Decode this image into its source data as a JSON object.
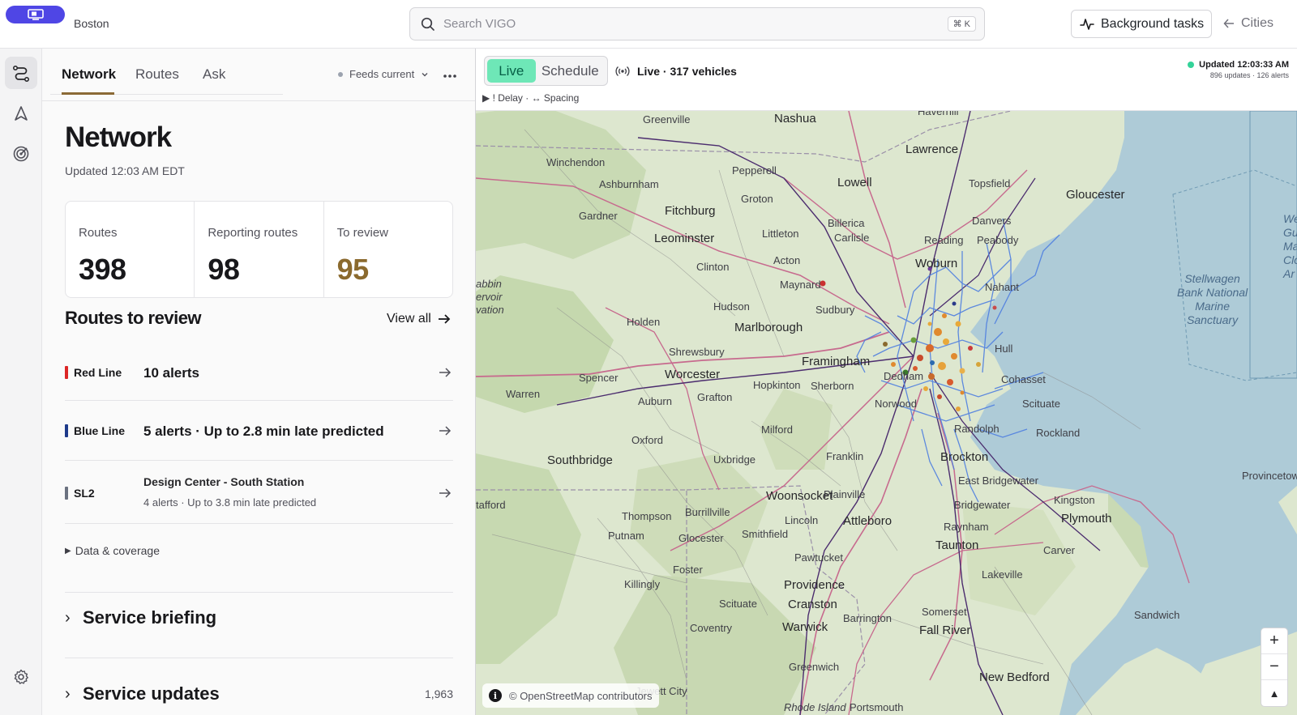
{
  "app": {
    "city": "Boston",
    "search_placeholder": "Search VIGO",
    "search_shortcut": "⌘ K",
    "background_tasks": "Background tasks",
    "cities_link": "Cities"
  },
  "rail": {
    "items": [
      "network-icon",
      "navigation-icon",
      "radar-icon"
    ],
    "bottom": "settings-icon"
  },
  "panel": {
    "tabs": [
      {
        "label": "Network",
        "active": true
      },
      {
        "label": "Routes",
        "active": false
      },
      {
        "label": "Ask",
        "active": false
      }
    ],
    "feeds_status": "Feeds current",
    "title": "Network",
    "updated": "Updated 12:03 AM EDT",
    "stats": [
      {
        "label": "Routes",
        "value": "398"
      },
      {
        "label": "Reporting routes",
        "value": "98"
      },
      {
        "label": "To review",
        "value": "95"
      }
    ],
    "review_title": "Routes to review",
    "view_all": "View all",
    "review_items": [
      {
        "name": "Red Line",
        "color": "#dc2626",
        "main": "10 alerts"
      },
      {
        "name": "Blue Line",
        "color": "#1e3a8a",
        "main": "5 alerts · Up to 2.8 min late predicted"
      },
      {
        "name": "SL2",
        "color": "#6b7280",
        "title": "Design Center - South Station",
        "sub": "4 alerts · Up to 3.8 min late predicted"
      }
    ],
    "data_coverage": "Data & coverage",
    "service_briefing": "Service briefing",
    "service_updates": "Service updates",
    "service_updates_count": "1,963"
  },
  "map": {
    "mode_live": "Live",
    "mode_schedule": "Schedule",
    "live_status": "Live · 317 vehicles",
    "legend": "▶ ! Delay · ↔ Spacing",
    "updated": "Updated 12:03:33 AM",
    "updated_sub": "896 updates · 126 alerts",
    "attribution": "© OpenStreetMap contributors",
    "zoom_in": "+",
    "zoom_out": "−",
    "reset_north": "▲",
    "places": {
      "haverhill": "Haverhill",
      "nashua": "Nashua",
      "greenville": "Greenville",
      "lawrence": "Lawrence",
      "winchendon": "Winchendon",
      "ashburnham": "Ashburnham",
      "pepperell": "Pepperell",
      "lowell": "Lowell",
      "topsfield": "Topsfield",
      "gloucester": "Gloucester",
      "groton": "Groton",
      "gardner": "Gardner",
      "fitchburg": "Fitchburg",
      "billerica": "Billerica",
      "danvers": "Danvers",
      "leominster": "Leominster",
      "littleton": "Littleton",
      "carlisle": "Carlisle",
      "reading": "Reading",
      "peabody": "Peabody",
      "acton": "Acton",
      "woburn": "Woburn",
      "petersham": "abbin\nervoir\nvation",
      "clinton": "Clinton",
      "maynard": "Maynard",
      "nahant": "Nahant",
      "hudson": "Hudson",
      "sudbury": "Sudbury",
      "holden": "Holden",
      "marlborough": "Marlborough",
      "shrewsbury": "Shrewsbury",
      "framingham": "Framingham",
      "worcester": "Worcester",
      "hull": "Hull",
      "dedham": "Dedham",
      "cohasset": "Cohasset",
      "spencer": "Spencer",
      "warren": "Warren",
      "hopkinton": "Hopkinton",
      "sherborn": "Sherborn",
      "auburn": "Auburn",
      "grafton": "Grafton",
      "norwood": "Norwood",
      "scituate": "Scituate",
      "randolph": "Randolph",
      "milford": "Milford",
      "oxford": "Oxford",
      "rockland": "Rockland",
      "southbridge": "Southbridge",
      "uxbridge": "Uxbridge",
      "franklin": "Franklin",
      "brockton": "Brockton",
      "east_bridgewater": "East Bridgewater",
      "kingston": "Kingston",
      "woonsocket": "Woonsocket",
      "plainville": "Plainville",
      "tafford": "tafford",
      "thompson": "Thompson",
      "burrillville": "Burrillville",
      "lincoln": "Lincoln",
      "attleboro": "Attleboro",
      "bridgewater": "Bridgewater",
      "plymouth": "Plymouth",
      "putnam": "Putnam",
      "glocester": "Glocester",
      "smithfield": "Smithfield",
      "raynham": "Raynham",
      "taunton": "Taunton",
      "carver": "Carver",
      "pawtucket": "Pawtucket",
      "killingly": "Killingly",
      "foster": "Foster",
      "providence": "Providence",
      "lakeville": "Lakeville",
      "scituate_ri": "Scituate",
      "cranston": "Cranston",
      "barrington": "Barrington",
      "somerset": "Somerset",
      "coventry": "Coventry",
      "warwick": "Warwick",
      "fall_river": "Fall River",
      "sandwich": "Sandwich",
      "jewett_city": "Jewett City",
      "greenwich": "Greenwich",
      "new_bedford": "New Bedford",
      "rhode_island": "Rhode Island",
      "portsmouth": "Portsmouth",
      "provincetown": "Provincetow",
      "stellwagen": "Stellwagen\nBank National\nMarine\nSanctuary",
      "west_gulf": "Wes\nGu\nMa\nClo\nAr"
    }
  }
}
